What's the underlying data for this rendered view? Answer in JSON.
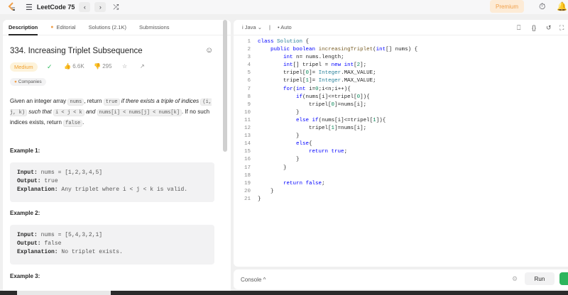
{
  "nav": {
    "title": "LeetCode 75",
    "back_glyph": "‹",
    "forward_glyph": "›",
    "premium_label": "Premium",
    "icons": [
      "leetcode-logo",
      "list-icon",
      "shuffle-icon",
      "timer-icon",
      "bell-icon"
    ]
  },
  "tabs": [
    {
      "label": "Description"
    },
    {
      "label": "Editorial"
    },
    {
      "label": "Solutions (2.1K)"
    },
    {
      "label": "Submissions"
    }
  ],
  "problem": {
    "title": "334. Increasing Triplet Subsequence",
    "difficulty": "Medium",
    "likes": "6.6K",
    "dislikes": "295",
    "companies_label": "Companies",
    "desc": {
      "p1": "Given an integer array ",
      "c_nums": "nums",
      "p2": ", return ",
      "c_true": "true",
      "i1": " if there exists a triple of indices ",
      "c_ijk": "(i, j, k)",
      "i2": " such that ",
      "c_cond": "i < j < k",
      "i3": " and ",
      "c_cond2": "nums[i] < nums[j] < nums[k]",
      "p3": ". If no such indices exists, return ",
      "c_false": "false",
      "p4": "."
    },
    "examples": [
      {
        "title": "Example 1:",
        "input": "nums = [1,2,3,4,5]",
        "output": "true",
        "explanation": "Any triplet where i < j < k is valid."
      },
      {
        "title": "Example 2:",
        "input": "nums = [5,4,3,2,1]",
        "output": "false",
        "explanation": "No triplet exists."
      },
      {
        "title": "Example 3:"
      }
    ],
    "labels": {
      "input": "Input:",
      "output": "Output:",
      "explanation": "Explanation:"
    }
  },
  "editor": {
    "language": "Java",
    "mode": "Auto",
    "lines": [
      "class Solution {",
      "    public boolean increasingTriplet(int[] nums) {",
      "        int n= nums.length;",
      "        int[] tripel = new int[2];",
      "        tripel[0]= Integer.MAX_VALUE;",
      "        tripel[1]= Integer.MAX_VALUE;",
      "        for(int i=0;i<n;i++){",
      "            if(nums[i]<=tripel[0]){",
      "                tripel[0]=nums[i];",
      "            }",
      "            else if(nums[i]<=tripel[1]){",
      "                tripel[1]=nums[i];",
      "            }",
      "            else{",
      "                return true;",
      "            }",
      "        }",
      "",
      "        return false;",
      "    }",
      "}"
    ]
  },
  "console": {
    "label": "Console",
    "run_label": "Run"
  }
}
